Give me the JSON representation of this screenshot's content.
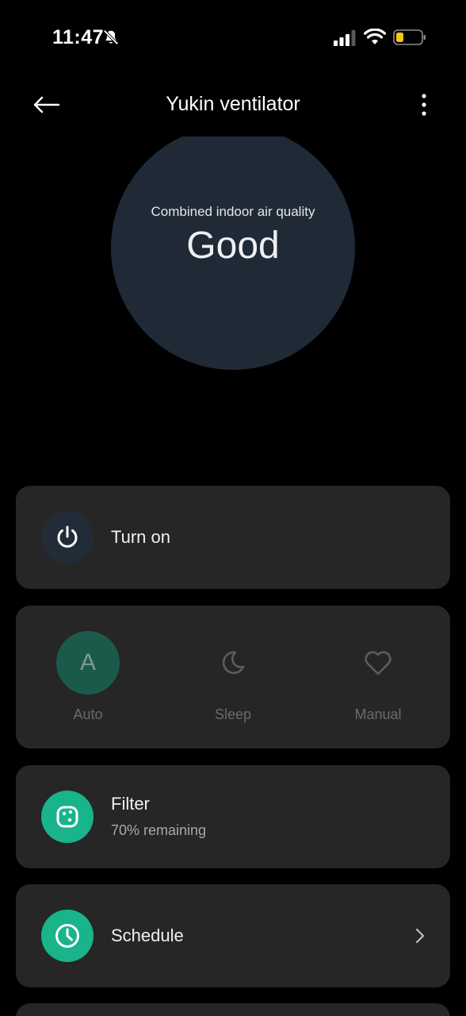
{
  "status_bar": {
    "time": "11:47",
    "icons": [
      "bell-slash-icon",
      "cellular-signal-icon",
      "wifi-icon",
      "battery-low-icon"
    ]
  },
  "app_bar": {
    "title": "Yukin ventilator",
    "back_icon": "arrow-left-icon",
    "more_icon": "more-vertical-icon"
  },
  "air_quality": {
    "label": "Combined indoor air quality",
    "value": "Good"
  },
  "power": {
    "label": "Turn on",
    "icon": "power-icon"
  },
  "modes": [
    {
      "label": "Auto",
      "icon_text": "A",
      "selected": true
    },
    {
      "label": "Sleep",
      "icon": "moon-icon",
      "selected": false
    },
    {
      "label": "Manual",
      "icon": "heart-icon",
      "selected": false
    }
  ],
  "filter": {
    "label": "Filter",
    "status": "70% remaining",
    "remaining_fraction": 0.7,
    "icon": "filter-icon"
  },
  "schedule": {
    "label": "Schedule",
    "icon": "clock-icon",
    "chevron_icon": "chevron-right-icon"
  },
  "colors": {
    "accent": "#19b38c",
    "card": "#262626",
    "circle": "#202a36",
    "battery": "#f5c518"
  }
}
